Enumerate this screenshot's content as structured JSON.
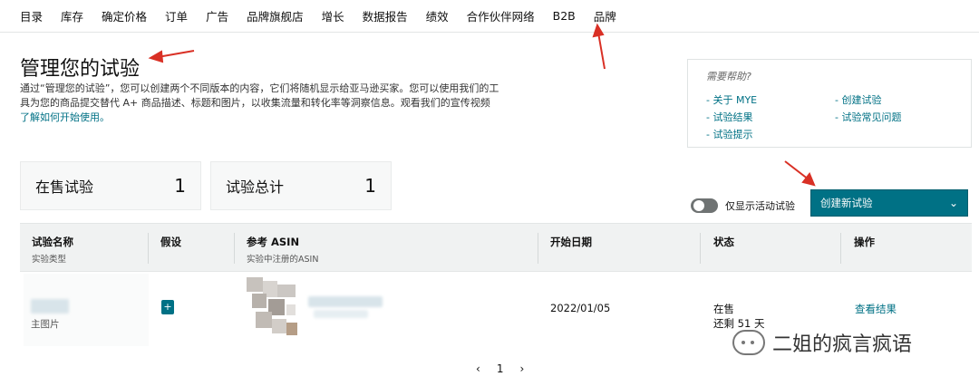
{
  "nav": {
    "items": [
      "目录",
      "库存",
      "确定价格",
      "订单",
      "广告",
      "品牌旗舰店",
      "增长",
      "数据报告",
      "绩效",
      "合作伙伴网络",
      "B2B",
      "品牌"
    ]
  },
  "page": {
    "title": "管理您的试验",
    "description": "通过“管理您的试验”，您可以创建两个不同版本的内容，它们将随机显示给亚马逊买家。您可以使用我们的工具为您的商品提交替代 A+ 商品描述、标题和图片，以收集流量和转化率等洞察信息。观看我们的宣传视频 ",
    "learn_link": "了解如何开始使用。"
  },
  "help": {
    "title": "需要帮助?",
    "links": [
      "- 关于 MYE",
      "- 创建试验",
      "- 试验结果",
      "- 试验常见问题",
      "- 试验提示"
    ]
  },
  "stats": [
    {
      "label": "在售试验",
      "value": "1"
    },
    {
      "label": "试验总计",
      "value": "1"
    }
  ],
  "filters": {
    "toggle_label": "仅显示活动试验",
    "create_label": "创建新试验"
  },
  "table": {
    "headers": [
      {
        "main": "试验名称",
        "sub": "实验类型"
      },
      {
        "main": "假设",
        "sub": ""
      },
      {
        "main": "参考 ASIN",
        "sub": "实验中注册的ASIN"
      },
      {
        "main": "开始日期",
        "sub": ""
      },
      {
        "main": "状态",
        "sub": ""
      },
      {
        "main": "操作",
        "sub": ""
      }
    ],
    "row": {
      "type": "主图片",
      "start_date": "2022/01/05",
      "status": "在售",
      "remaining": "还剩 51 天",
      "action": "查看结果"
    }
  },
  "pager": {
    "prev": "‹",
    "page": "1",
    "next": "›"
  },
  "watermark": {
    "text": "二姐的疯言疯语"
  },
  "colors": {
    "accent": "#007185",
    "annotation": "#d93025"
  }
}
